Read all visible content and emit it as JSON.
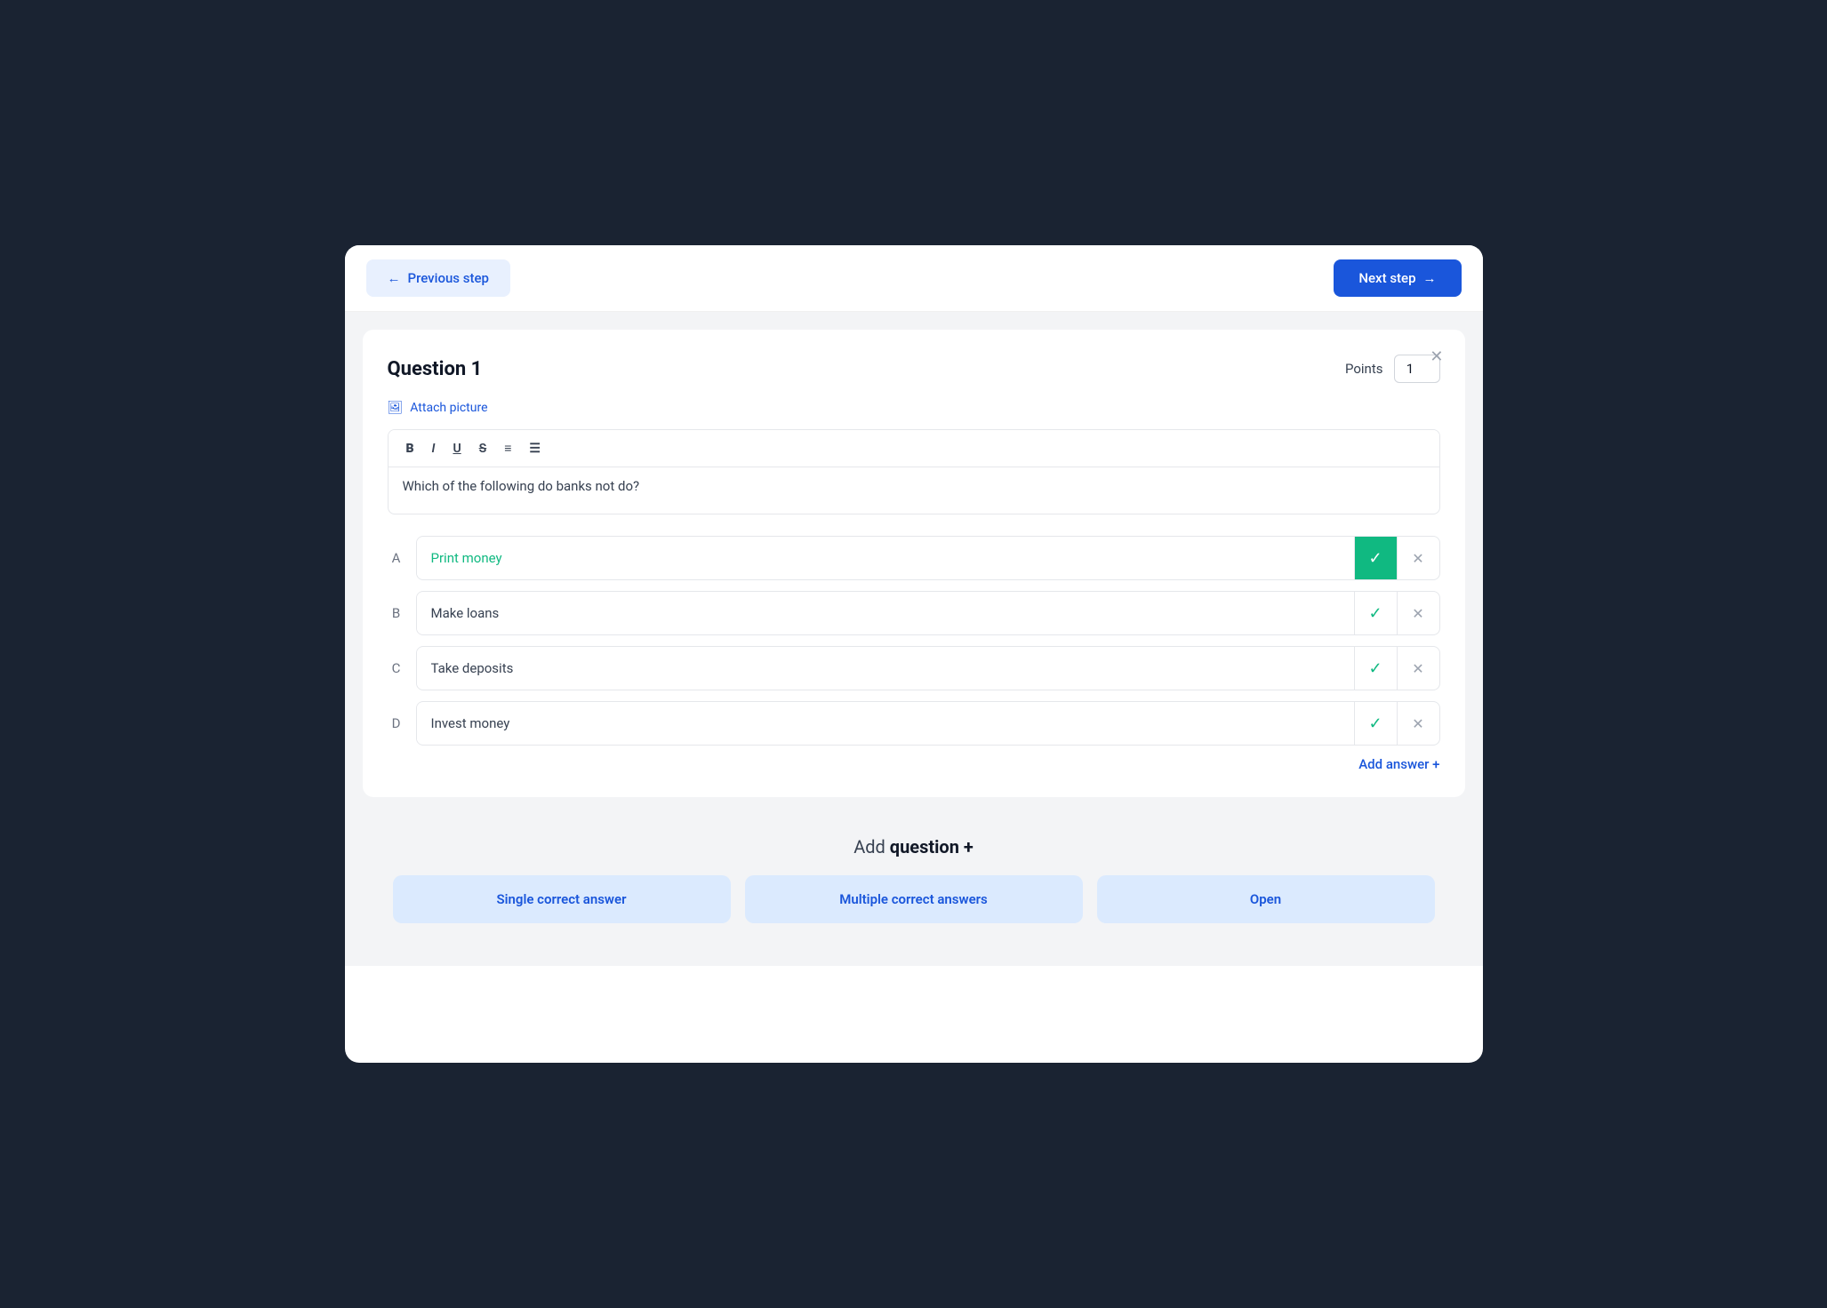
{
  "header": {
    "prev_label": "Previous step",
    "next_label": "Next step"
  },
  "question": {
    "title": "Question 1",
    "points_label": "Points",
    "points_value": "1",
    "attach_label": "Attach picture",
    "question_text": "Which of the following do banks not do?",
    "toolbar_buttons": [
      "B",
      "I",
      "U",
      "S",
      "≡",
      "≡"
    ],
    "answers": [
      {
        "letter": "A",
        "text": "Print money",
        "is_correct": true,
        "is_correct_active": true
      },
      {
        "letter": "B",
        "text": "Make loans",
        "is_correct": false,
        "is_correct_active": false
      },
      {
        "letter": "C",
        "text": "Take deposits",
        "is_correct": false,
        "is_correct_active": false
      },
      {
        "letter": "D",
        "text": "Invest money",
        "is_correct": false,
        "is_correct_active": false
      }
    ],
    "add_answer_label": "Add answer +"
  },
  "add_question": {
    "prefix": "Add ",
    "strong": "question +",
    "buttons": [
      {
        "label": "Single correct answer"
      },
      {
        "label": "Multiple correct answers"
      },
      {
        "label": "Open"
      }
    ]
  }
}
